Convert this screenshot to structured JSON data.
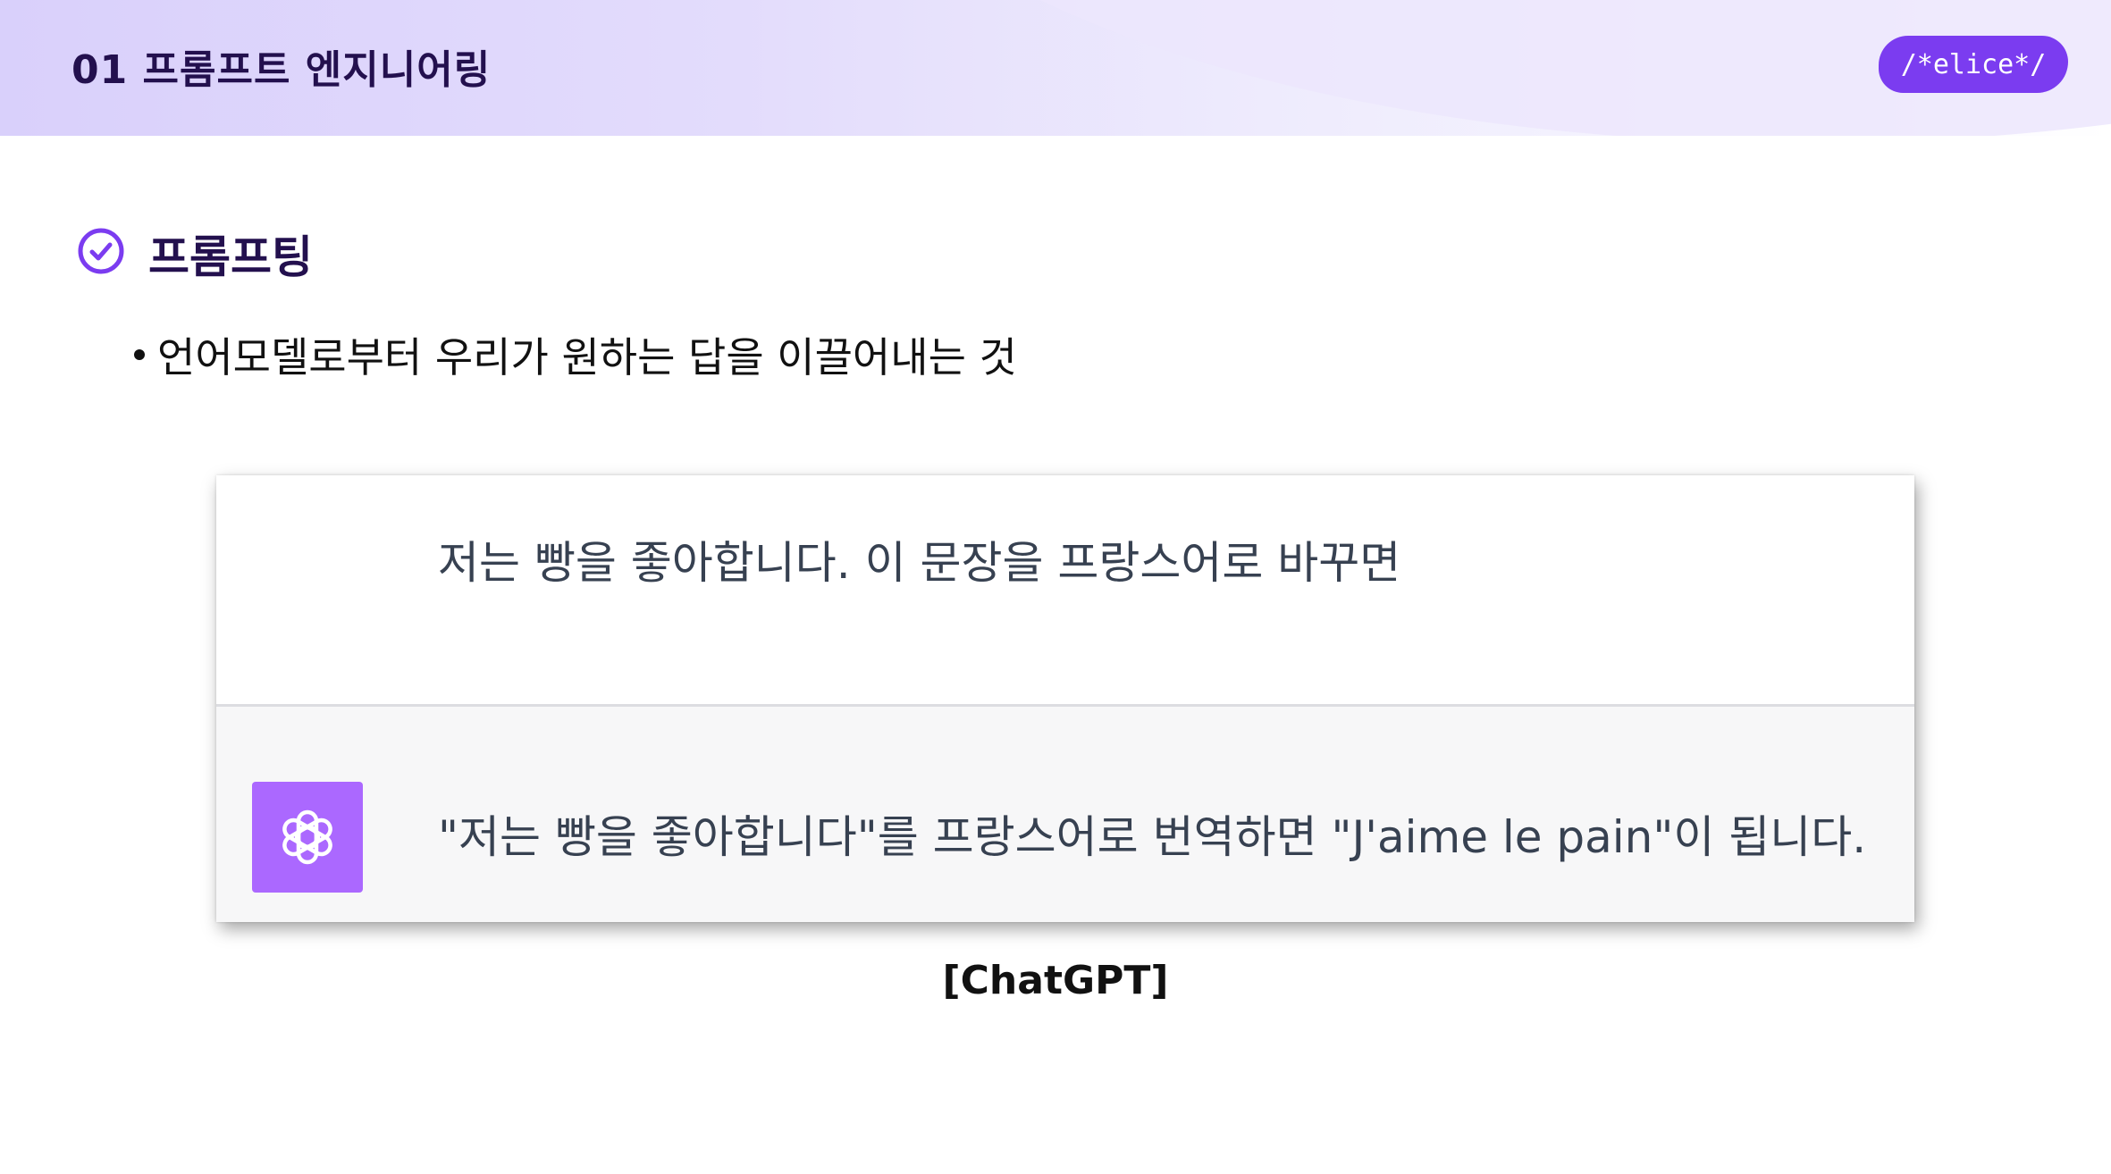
{
  "header": {
    "title": "01  프롬프트 엔지니어링",
    "logo_text": "/*elice*/"
  },
  "section": {
    "title": "프롬프팅",
    "bullet": "언어모델로부터 우리가 원하는 답을 이끌어내는 것",
    "icon": "check-circle-icon"
  },
  "chat": {
    "user_message": "저는 빵을 좋아합니다. 이 문장을 프랑스어로 바꾸면",
    "assistant_message": "\"저는 빵을 좋아합니다\"를 프랑스어로 번역하면 \"J'aime le pain\"이 됩니다.",
    "assistant_icon": "openai-logo-icon",
    "avatar_color": "#ab68ff"
  },
  "caption": "[ChatGPT]",
  "colors": {
    "accent": "#7b3cf0",
    "title_text": "#23104e"
  }
}
